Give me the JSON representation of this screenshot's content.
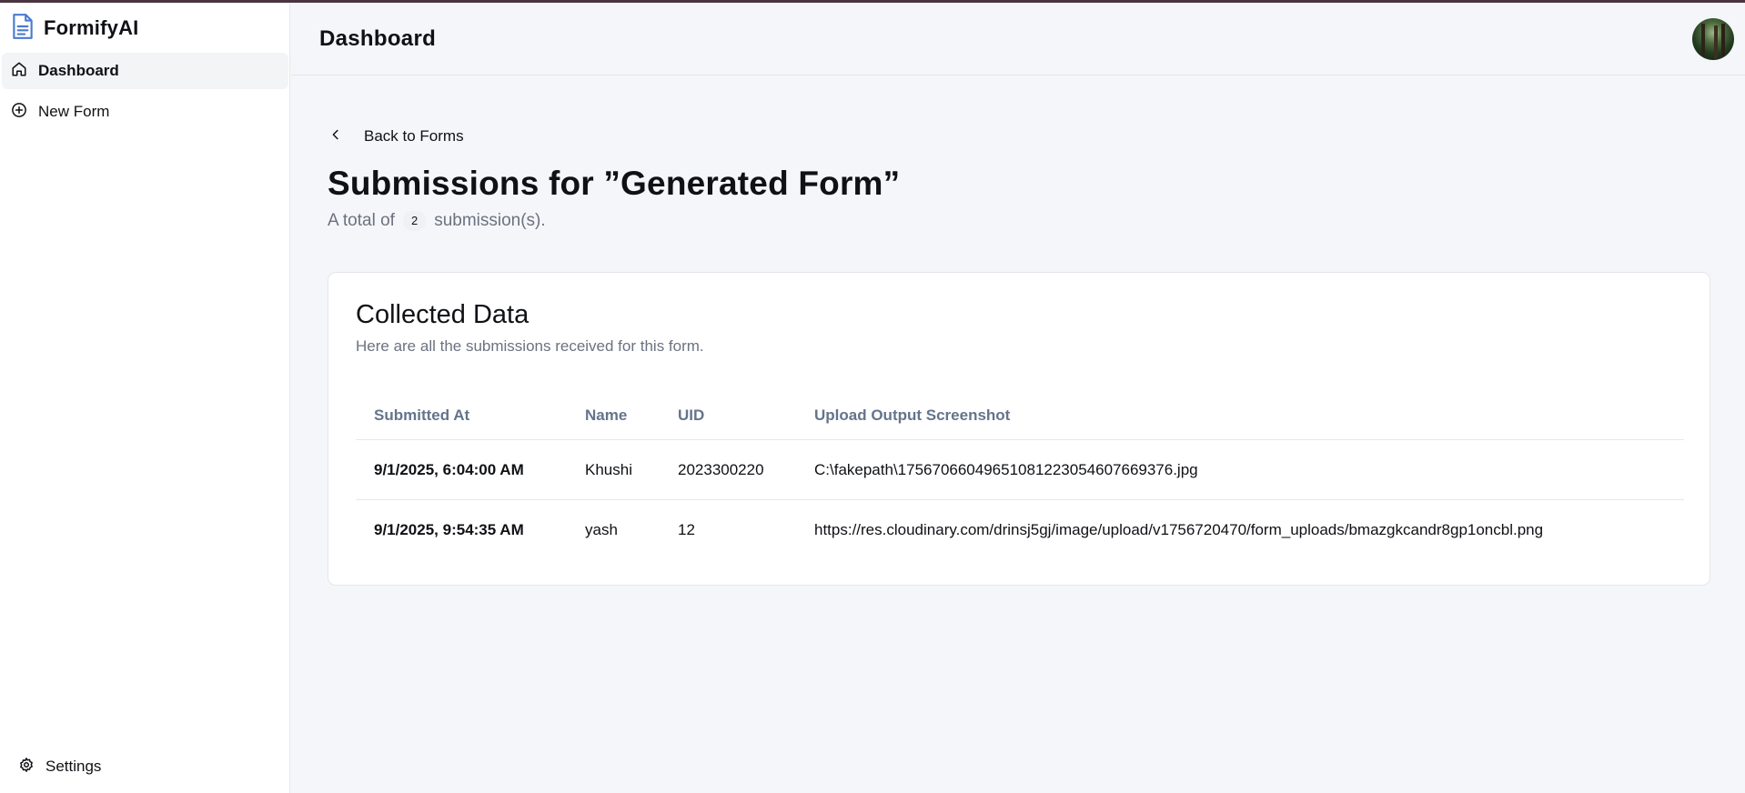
{
  "brand": {
    "name": "FormifyAI"
  },
  "sidebar": {
    "items": [
      {
        "label": "Dashboard",
        "icon": "home-icon"
      },
      {
        "label": "New Form",
        "icon": "plus-circle-icon"
      }
    ],
    "settings_label": "Settings"
  },
  "header": {
    "title": "Dashboard"
  },
  "main": {
    "back_label": "Back to Forms",
    "title": "Submissions for ”Generated Form”",
    "subtitle_prefix": "A total of",
    "count": "2",
    "subtitle_suffix": "submission(s)."
  },
  "card": {
    "title": "Collected Data",
    "description": "Here are all the submissions received for this form.",
    "columns": [
      "Submitted At",
      "Name",
      "UID",
      "Upload Output Screenshot"
    ],
    "rows": [
      [
        "9/1/2025, 6:04:00 AM",
        "Khushi",
        "2023300220",
        "C:\\fakepath\\1756706604965108122305460766​9376.jpg"
      ],
      [
        "9/1/2025, 9:54:35 AM",
        "yash",
        "12",
        "https://res.cloudinary.com/drinsj5gj/image/upload/v1756720470/form_uploads/bmazgkcandr8gp1oncbl.png"
      ]
    ]
  },
  "colors": {
    "accent": "#4a7bd0",
    "muted": "#6b7280",
    "header_text": "#64748b"
  }
}
